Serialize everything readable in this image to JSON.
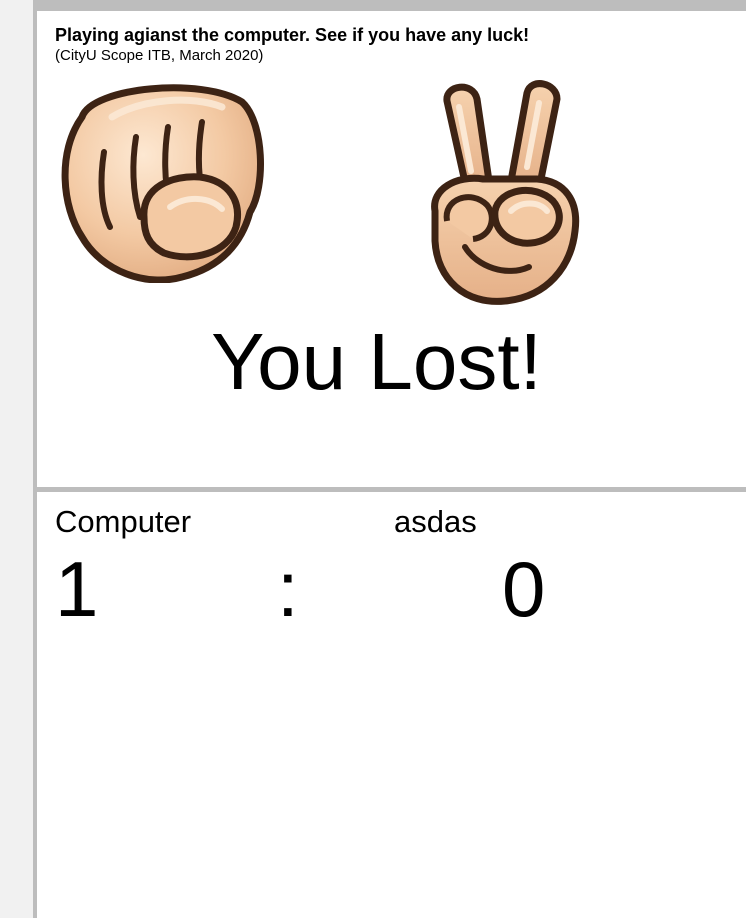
{
  "header": {
    "title": "Playing agianst the computer. See if you have any luck!",
    "subtitle": "(CityU Scope ITB, March 2020)"
  },
  "hands": {
    "computer": {
      "icon": "rock-fist-icon"
    },
    "player": {
      "icon": "scissors-peace-hand-icon"
    }
  },
  "result": {
    "text": "You Lost!"
  },
  "scoreboard": {
    "computer_name": "Computer",
    "player_name": "asdas",
    "computer_score": "1",
    "separator": ":",
    "player_score": "0"
  },
  "colors": {
    "skin_light": "#fbe1c5",
    "skin_mid": "#f0c39b",
    "skin_shade": "#d9a27a",
    "outline": "#3d2314",
    "frame": "#bdbdbd",
    "background": "#ffffff"
  }
}
